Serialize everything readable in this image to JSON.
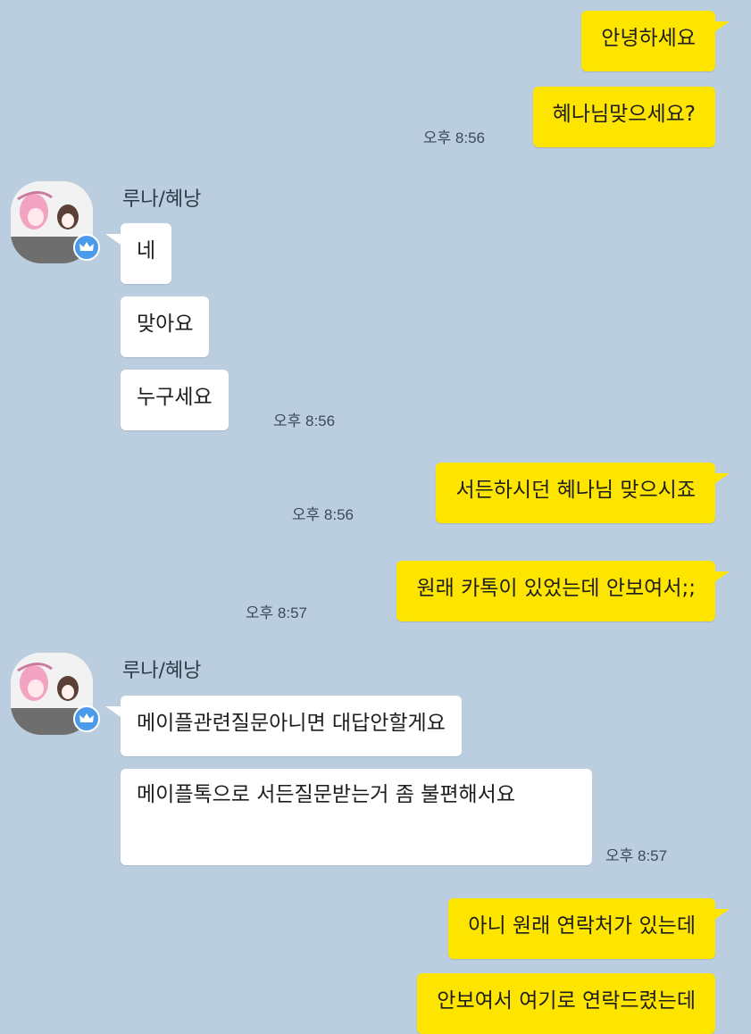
{
  "colors": {
    "background": "#bacee0",
    "my_bubble": "#fee500",
    "their_bubble": "#ffffff",
    "badge": "#4a9bea"
  },
  "messages": {
    "m1": "안녕하세요",
    "m2": "혜나님맞으세요?",
    "t1": "오후 8:56",
    "sender1": "루나/혜낭",
    "r1": "네",
    "r2": "맞아요",
    "r3": "누구세요",
    "t2": "오후 8:56",
    "m3": "서든하시던 혜나님 맞으시죠",
    "t3": "오후 8:56",
    "m4": "원래 카톡이 있었는데 안보여서;;",
    "t4": "오후 8:57",
    "sender2": "루나/혜낭",
    "r4": "메이플관련질문아니면 대답안할게요",
    "r5": "메이플톡으로 서든질문받는거 좀 불편해서요",
    "t5": "오후 8:57",
    "m5": "아니 원래 연락처가 있는데",
    "m6": "안보여서 여기로 연락드렸는데"
  },
  "icons": {
    "avatar": "anime-profile-avatar",
    "badge": "crown-icon"
  }
}
